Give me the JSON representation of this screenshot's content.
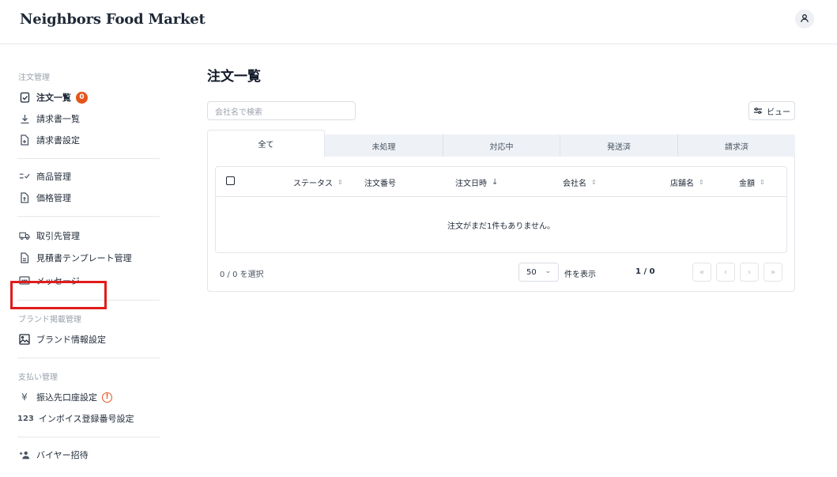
{
  "app": {
    "title": "Neighbors Food Market"
  },
  "icons": {
    "user": "user-icon"
  },
  "colors": {
    "accent": "#e5541b",
    "highlight": "#e01c1c"
  },
  "sidebar": {
    "sections": [
      {
        "title": "注文管理"
      },
      {
        "title": "ブランド掲載管理"
      },
      {
        "title": "支払い管理"
      }
    ],
    "items": {
      "orders": {
        "label": "注文一覧",
        "badge": "0"
      },
      "invoices": {
        "label": "請求書一覧"
      },
      "invoice_settings": {
        "label": "請求書設定"
      },
      "products": {
        "label": "商品管理"
      },
      "prices": {
        "label": "価格管理"
      },
      "partners": {
        "label": "取引先管理"
      },
      "quote_templates": {
        "label": "見積書テンプレート管理"
      },
      "messages": {
        "label": "メッセージ"
      },
      "brand_info": {
        "label": "ブランド情報設定"
      },
      "bank_account": {
        "label": "振込先口座設定",
        "alert": "!"
      },
      "invoice_number": {
        "label": "インボイス登録番号設定",
        "icon_text": "123"
      },
      "invite_buyer": {
        "label": "バイヤー招待"
      }
    }
  },
  "main": {
    "title": "注文一覧",
    "search_placeholder": "会社名で検索",
    "view_button": "ビュー",
    "tabs": [
      "全て",
      "未処理",
      "対応中",
      "発送済",
      "請求済"
    ],
    "columns": [
      "ステータス",
      "注文番号",
      "注文日時",
      "会社名",
      "店舗名",
      "金額"
    ],
    "empty_message": "注文がまだ1件もありません。",
    "selection": "0 / 0 を選択",
    "per_page_value": "50",
    "per_page_label": "件を表示",
    "page_info": "1 / 0"
  }
}
